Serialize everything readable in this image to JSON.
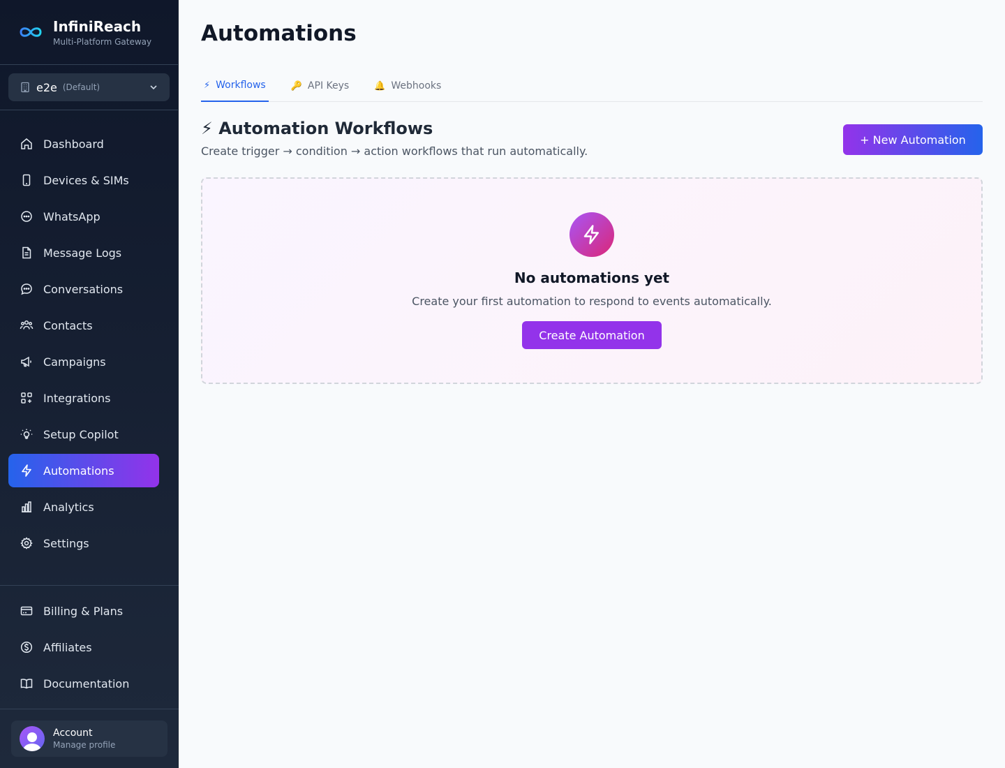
{
  "brand": {
    "name": "InfiniReach",
    "subtitle": "Multi-Platform Gateway"
  },
  "workspace": {
    "name": "e2e",
    "tag": "(Default)"
  },
  "nav": {
    "items": [
      {
        "label": "Dashboard",
        "icon": "home-icon"
      },
      {
        "label": "Devices & SIMs",
        "icon": "phone-icon"
      },
      {
        "label": "WhatsApp",
        "icon": "chat-circle-icon"
      },
      {
        "label": "Message Logs",
        "icon": "document-icon"
      },
      {
        "label": "Conversations",
        "icon": "message-bubble-icon"
      },
      {
        "label": "Contacts",
        "icon": "users-icon"
      },
      {
        "label": "Campaigns",
        "icon": "megaphone-icon"
      },
      {
        "label": "Integrations",
        "icon": "grid-plus-icon"
      },
      {
        "label": "Setup Copilot",
        "icon": "lightbulb-icon"
      },
      {
        "label": "Automations",
        "icon": "bolt-icon",
        "active": true
      },
      {
        "label": "Analytics",
        "icon": "bar-chart-icon"
      },
      {
        "label": "Settings",
        "icon": "gear-icon"
      }
    ],
    "bottom": [
      {
        "label": "Billing & Plans",
        "icon": "credit-card-icon"
      },
      {
        "label": "Affiliates",
        "icon": "dollar-circle-icon"
      },
      {
        "label": "Documentation",
        "icon": "book-icon"
      }
    ]
  },
  "account": {
    "name": "Account",
    "subtitle": "Manage profile"
  },
  "page": {
    "title": "Automations"
  },
  "tabs": [
    {
      "icon": "⚡",
      "label": "Workflows",
      "active": true
    },
    {
      "icon": "🔑",
      "label": "API Keys"
    },
    {
      "icon": "🔔",
      "label": "Webhooks"
    }
  ],
  "section": {
    "title": "⚡ Automation Workflows",
    "subtitle": "Create trigger → condition → action workflows that run automatically.",
    "new_button": "+ New Automation"
  },
  "empty_state": {
    "title": "No automations yet",
    "subtitle": "Create your first automation to respond to events automatically.",
    "button": "Create Automation"
  },
  "colors": {
    "accent_blue": "#2563eb",
    "accent_purple": "#9333ea",
    "sidebar_bg": "#0f172a"
  }
}
